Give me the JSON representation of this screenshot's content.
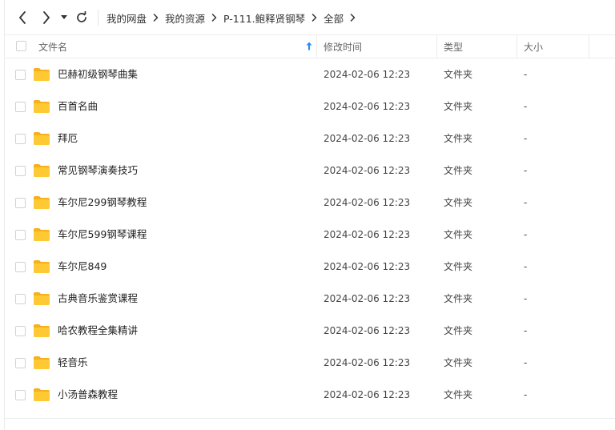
{
  "breadcrumb": [
    {
      "label": "我的网盘"
    },
    {
      "label": "我的资源"
    },
    {
      "label": "P-111.鲍释贤钢琴"
    },
    {
      "label": "全部"
    }
  ],
  "columns": {
    "name": "文件名",
    "modified": "修改时间",
    "type": "类型",
    "size": "大小"
  },
  "colors": {
    "folder": "#FFC933",
    "folder_back": "#F5B01E",
    "sort_arrow": "#1E8FFF"
  },
  "files": [
    {
      "name": "巴赫初级钢琴曲集",
      "modified": "2024-02-06 12:23",
      "type": "文件夹",
      "size": "-"
    },
    {
      "name": "百首名曲",
      "modified": "2024-02-06 12:23",
      "type": "文件夹",
      "size": "-"
    },
    {
      "name": "拜厄",
      "modified": "2024-02-06 12:23",
      "type": "文件夹",
      "size": "-"
    },
    {
      "name": "常见钢琴演奏技巧",
      "modified": "2024-02-06 12:23",
      "type": "文件夹",
      "size": "-"
    },
    {
      "name": "车尔尼299钢琴教程",
      "modified": "2024-02-06 12:23",
      "type": "文件夹",
      "size": "-"
    },
    {
      "name": "车尔尼599钢琴课程",
      "modified": "2024-02-06 12:23",
      "type": "文件夹",
      "size": "-"
    },
    {
      "name": "车尔尼849",
      "modified": "2024-02-06 12:23",
      "type": "文件夹",
      "size": "-"
    },
    {
      "name": "古典音乐鉴赏课程",
      "modified": "2024-02-06 12:23",
      "type": "文件夹",
      "size": "-"
    },
    {
      "name": "哈农教程全集精讲",
      "modified": "2024-02-06 12:23",
      "type": "文件夹",
      "size": "-"
    },
    {
      "name": "轻音乐",
      "modified": "2024-02-06 12:23",
      "type": "文件夹",
      "size": "-"
    },
    {
      "name": "小汤普森教程",
      "modified": "2024-02-06 12:23",
      "type": "文件夹",
      "size": "-"
    }
  ]
}
